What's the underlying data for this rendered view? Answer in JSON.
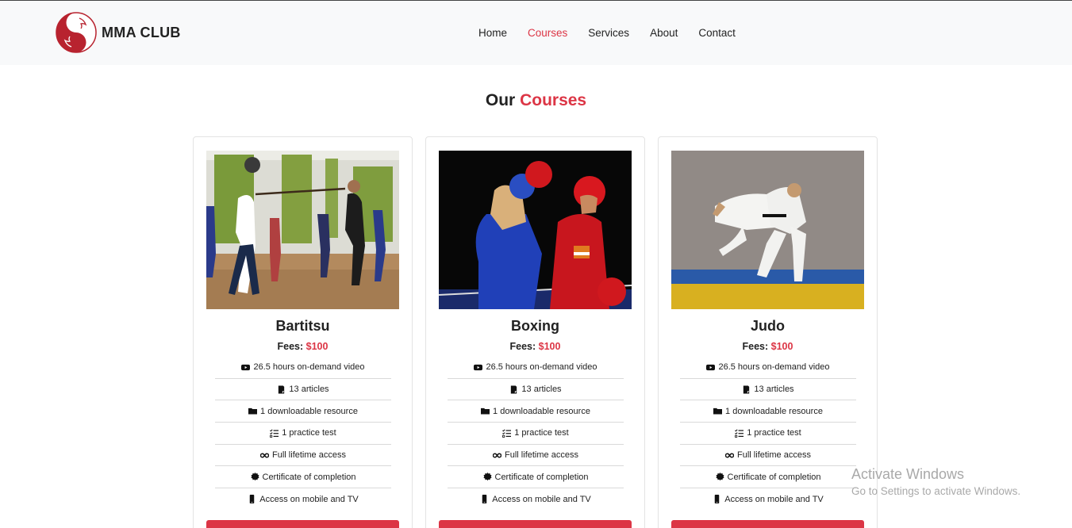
{
  "header": {
    "brand": "MMA CLUB",
    "nav": [
      {
        "label": "Home",
        "active": false
      },
      {
        "label": "Courses",
        "active": true
      },
      {
        "label": "Services",
        "active": false
      },
      {
        "label": "About",
        "active": false
      },
      {
        "label": "Contact",
        "active": false
      }
    ]
  },
  "section": {
    "title_prefix": "Our",
    "title_accent": "Courses"
  },
  "courses": [
    {
      "name": "Bartitsu",
      "fees_label": "Fees:",
      "price": "$100",
      "image": "bartitsu-class-photo",
      "features": [
        {
          "icon": "youtube-icon",
          "text": "26.5 hours on-demand video"
        },
        {
          "icon": "file-icon",
          "text": "13 articles"
        },
        {
          "icon": "folder-icon",
          "text": "1 downloadable resource"
        },
        {
          "icon": "checklist-icon",
          "text": "1 practice test"
        },
        {
          "icon": "infinity-icon",
          "text": "Full lifetime access"
        },
        {
          "icon": "certificate-icon",
          "text": "Certificate of completion"
        },
        {
          "icon": "mobile-icon",
          "text": "Access on mobile and TV"
        }
      ]
    },
    {
      "name": "Boxing",
      "fees_label": "Fees:",
      "price": "$100",
      "image": "boxing-match-photo",
      "features": [
        {
          "icon": "youtube-icon",
          "text": "26.5 hours on-demand video"
        },
        {
          "icon": "file-icon",
          "text": "13 articles"
        },
        {
          "icon": "folder-icon",
          "text": "1 downloadable resource"
        },
        {
          "icon": "checklist-icon",
          "text": "1 practice test"
        },
        {
          "icon": "infinity-icon",
          "text": "Full lifetime access"
        },
        {
          "icon": "certificate-icon",
          "text": "Certificate of completion"
        },
        {
          "icon": "mobile-icon",
          "text": "Access on mobile and TV"
        }
      ]
    },
    {
      "name": "Judo",
      "fees_label": "Fees:",
      "price": "$100",
      "image": "judo-throw-photo",
      "features": [
        {
          "icon": "youtube-icon",
          "text": "26.5 hours on-demand video"
        },
        {
          "icon": "file-icon",
          "text": "13 articles"
        },
        {
          "icon": "folder-icon",
          "text": "1 downloadable resource"
        },
        {
          "icon": "checklist-icon",
          "text": "1 practice test"
        },
        {
          "icon": "infinity-icon",
          "text": "Full lifetime access"
        },
        {
          "icon": "certificate-icon",
          "text": "Certificate of completion"
        },
        {
          "icon": "mobile-icon",
          "text": "Access on mobile and TV"
        }
      ]
    }
  ],
  "watermark": {
    "line1": "Activate Windows",
    "line2": "Go to Settings to activate Windows."
  },
  "colors": {
    "accent": "#dc3545",
    "navbar_bg": "#f8f9fa"
  }
}
